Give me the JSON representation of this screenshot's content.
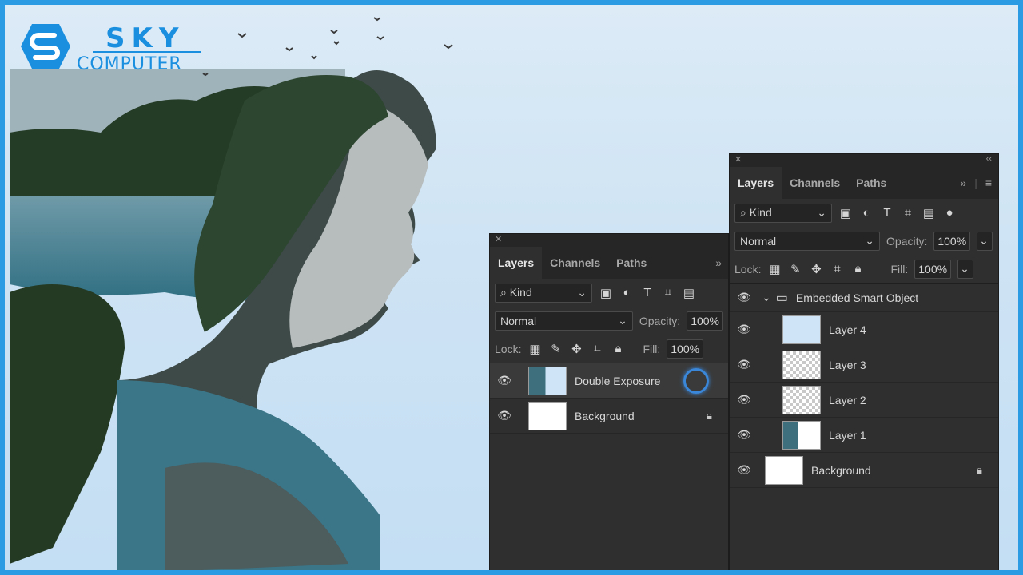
{
  "logo": {
    "top_text": "SKY",
    "bottom_text": "COMPUTER",
    "brand_color": "#1a8fe0"
  },
  "frame_color": "#2b9be3",
  "panel_front": {
    "tabs": [
      "Layers",
      "Channels",
      "Paths"
    ],
    "kind_label": "Kind",
    "blend_mode": "Normal",
    "opacity_label": "Opacity:",
    "opacity_value": "100%",
    "lock_label": "Lock:",
    "fill_label": "Fill:",
    "fill_value": "100%",
    "layers": [
      {
        "name": "Double Exposure"
      },
      {
        "name": "Background"
      }
    ]
  },
  "panel_back": {
    "tabs": [
      "Layers",
      "Channels",
      "Paths"
    ],
    "kind_label": "Kind",
    "blend_mode": "Normal",
    "opacity_label": "Opacity:",
    "opacity_value": "100%",
    "lock_label": "Lock:",
    "fill_label": "Fill:",
    "fill_value": "100%",
    "group": {
      "name": "Embedded Smart Object"
    },
    "layers": [
      {
        "name": "Layer 4"
      },
      {
        "name": "Layer 3"
      },
      {
        "name": "Layer 2"
      },
      {
        "name": "Layer 1"
      },
      {
        "name": "Background"
      }
    ]
  }
}
